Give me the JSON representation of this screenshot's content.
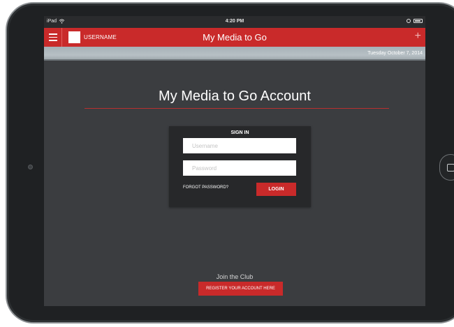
{
  "status_bar": {
    "device_label": "iPad",
    "time": "4:20 PM",
    "icons": [
      "wifi-icon",
      "alarm-icon",
      "battery-icon"
    ]
  },
  "app_bar": {
    "username": "USERNAME",
    "title": "My Media to Go",
    "plus_label": "+",
    "icons": [
      "hamburger-menu-icon",
      "plus-icon"
    ]
  },
  "date_bar": {
    "date": "Tuesday October 7, 2014"
  },
  "main": {
    "heading": "My Media to Go Account"
  },
  "sign_in": {
    "title": "SIGN IN",
    "username_placeholder": "Username",
    "username_value": "",
    "password_placeholder": "Password",
    "password_value": "",
    "forgot_label": "FORGOT PASSWORD?",
    "login_label": "LOGIN"
  },
  "footer": {
    "join_text": "Join the Club",
    "register_label": "REGISTER YOUR ACCOUNT HERE"
  },
  "colors": {
    "accent": "#c92a2a",
    "background": "#3b3d40",
    "card": "#27282a"
  }
}
